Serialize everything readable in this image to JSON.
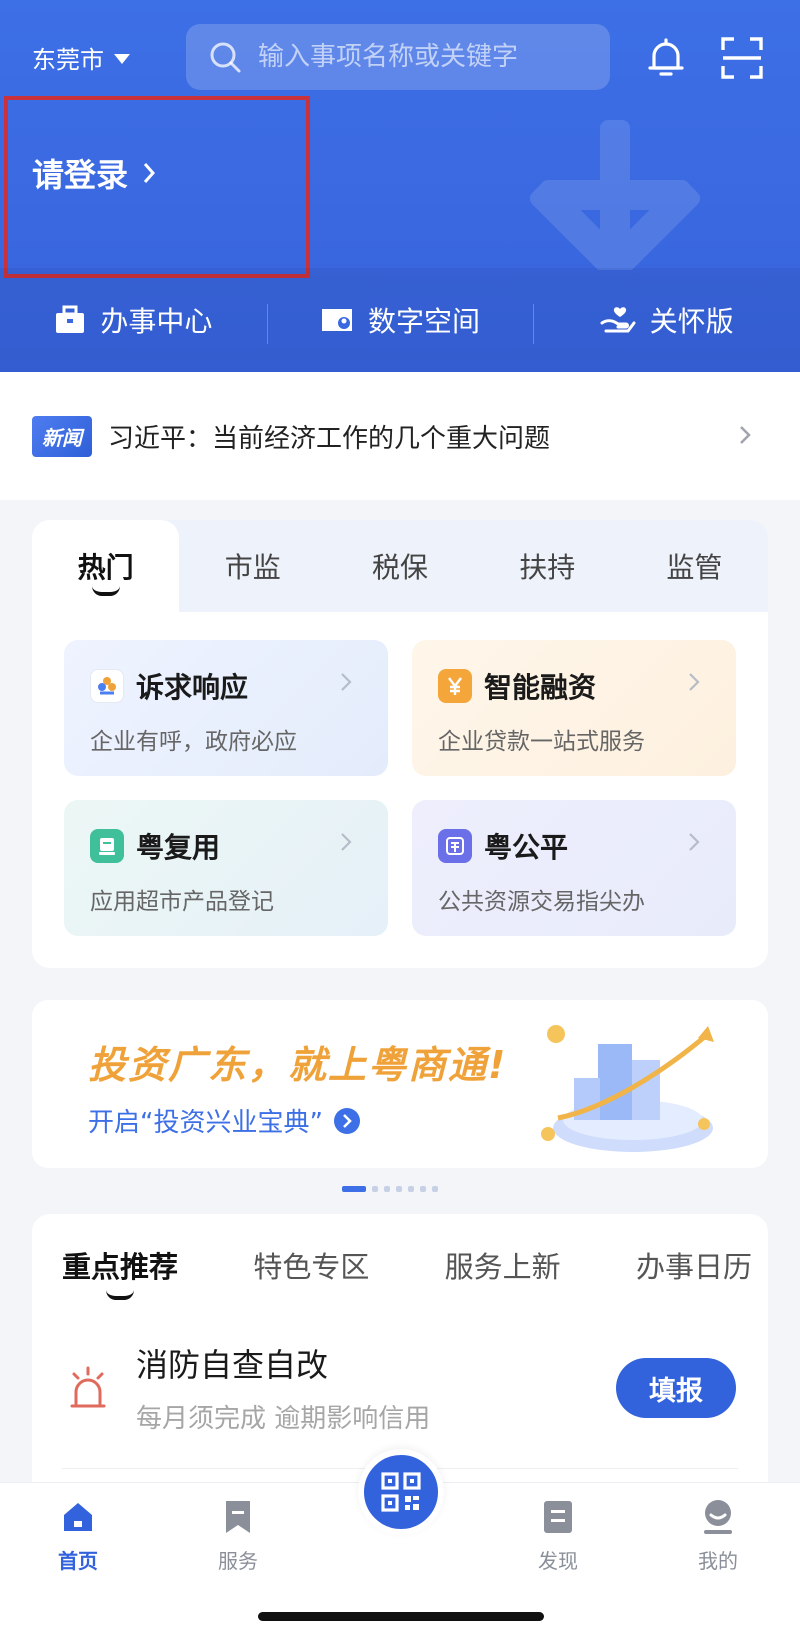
{
  "header": {
    "city": "东莞市",
    "search_placeholder": "输入事项名称或关键字",
    "login_label": "请登录",
    "quick_links": [
      {
        "label": "办事中心",
        "icon": "briefcase-icon"
      },
      {
        "label": "数字空间",
        "icon": "digital-space-icon"
      },
      {
        "label": "关怀版",
        "icon": "care-hand-icon"
      }
    ]
  },
  "news": {
    "tag": "新闻",
    "headline": "习近平：当前经济工作的几个重大问题"
  },
  "service_tabs": {
    "tabs": [
      "热门",
      "市监",
      "税保",
      "扶持",
      "监管"
    ],
    "active": "热门",
    "cards": [
      {
        "title": "诉求响应",
        "subtitle": "企业有呼，政府必应",
        "icon": "flower-icon",
        "color": "#f0a23a"
      },
      {
        "title": "智能融资",
        "subtitle": "企业贷款一站式服务",
        "icon": "yuan-icon",
        "color": "#f4a63b"
      },
      {
        "title": "粤复用",
        "subtitle": "应用超市产品登记",
        "icon": "reuse-icon",
        "color": "#3fbf9a"
      },
      {
        "title": "粤公平",
        "subtitle": "公共资源交易指尖办",
        "icon": "fair-icon",
        "color": "#6b6fe8"
      }
    ]
  },
  "banner": {
    "title": "投资广东，就上粤商通!",
    "subtitle": "开启“投资兴业宝典”",
    "page_count": 7,
    "current_page": 1
  },
  "recommend": {
    "tabs": [
      "重点推荐",
      "特色专区",
      "服务上新",
      "办事日历"
    ],
    "active": "重点推荐",
    "item": {
      "title": "消防自查自改",
      "subtitle": "每月须完成 逾期影响信用",
      "action": "填报"
    }
  },
  "bottom_nav": {
    "items": [
      {
        "label": "首页",
        "icon": "home-icon",
        "active": true
      },
      {
        "label": "服务",
        "icon": "bookmark-icon",
        "active": false
      },
      {
        "label": "发现",
        "icon": "discover-icon",
        "active": false
      },
      {
        "label": "我的",
        "icon": "profile-icon",
        "active": false
      }
    ],
    "center_icon": "qr-code-icon"
  },
  "colors": {
    "primary": "#3d6fe6",
    "accent_orange": "#f0a23a",
    "highlight_box": "#c9323a"
  }
}
